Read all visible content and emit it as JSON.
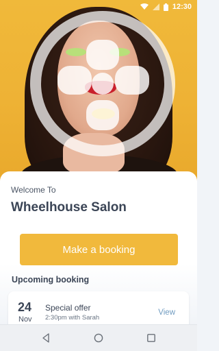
{
  "status_bar": {
    "time": "12:30",
    "icons": [
      "wifi-icon",
      "signal-icon",
      "battery-icon"
    ]
  },
  "hero": {
    "logo": "wheelhouse-logo"
  },
  "welcome": {
    "greeting": "Welcome To",
    "salon_name": "Wheelhouse Salon"
  },
  "actions": {
    "book_label": "Make a booking"
  },
  "upcoming": {
    "title": "Upcoming booking",
    "item": {
      "day": "24",
      "month": "Nov",
      "title": "Special offer",
      "subtitle": "2:30pm with Sarah",
      "action": "View"
    }
  },
  "navbar": {
    "icons": [
      "back-icon",
      "home-icon",
      "recents-icon"
    ]
  },
  "colors": {
    "accent": "#f1b93c",
    "text_dark": "#3b4556",
    "link": "#6f9bc0"
  }
}
